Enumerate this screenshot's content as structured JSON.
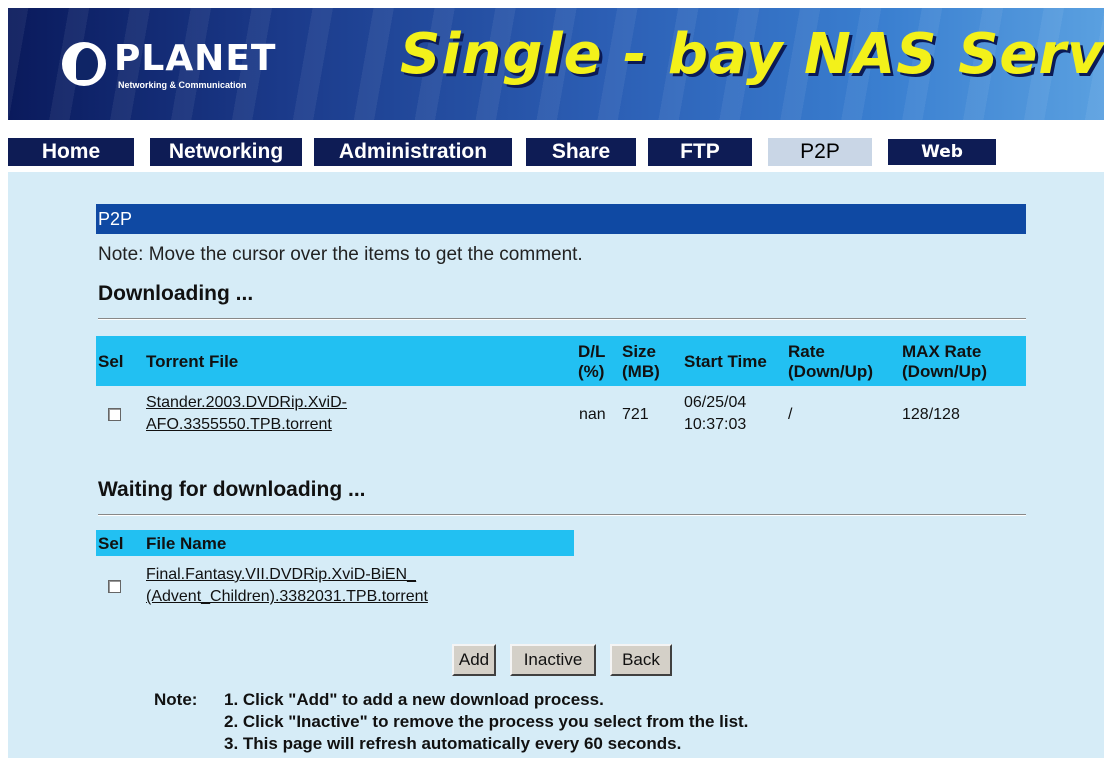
{
  "banner": {
    "logo_text": "PLANET",
    "logo_sub": "Networking & Communication",
    "title": "Single - bay NAS Server"
  },
  "tabs": [
    {
      "label": "Home"
    },
    {
      "label": "Networking"
    },
    {
      "label": "Administration"
    },
    {
      "label": "Share"
    },
    {
      "label": "FTP"
    },
    {
      "label": "P2P"
    },
    {
      "label": "Web Server"
    }
  ],
  "active_tab": "P2P",
  "section": {
    "title": "P2P",
    "note": "Note: Move the cursor over the items to get the comment."
  },
  "downloading": {
    "heading": "Downloading ...",
    "columns": {
      "sel": "Sel",
      "torrent": "Torrent File",
      "dl_1": "D/L",
      "dl_2": "(%)",
      "size_1": "Size",
      "size_2": "(MB)",
      "start": "Start Time",
      "rate_1": "Rate",
      "rate_2": "(Down/Up)",
      "max_1": "MAX Rate",
      "max_2": "(Down/Up)"
    },
    "rows": [
      {
        "file_line1": "Stander.2003.DVDRip.XviD-",
        "file_line2": "AFO.3355550.TPB.torrent",
        "dl": "nan",
        "size": "721",
        "start_date": "06/25/04",
        "start_time": "10:37:03",
        "rate": "/",
        "max_rate": "128/128",
        "selected": false
      }
    ]
  },
  "waiting": {
    "heading": "Waiting for downloading ...",
    "columns": {
      "sel": "Sel",
      "file": "File Name"
    },
    "rows": [
      {
        "file_line1": "Final.Fantasy.VII.DVDRip.XviD-BiEN_",
        "file_line2": "(Advent_Children).3382031.TPB.torrent",
        "selected": false
      }
    ]
  },
  "buttons": {
    "add": "Add",
    "inactive": "Inactive",
    "back": "Back"
  },
  "notes": {
    "label": "Note:",
    "items": [
      "1. Click \"Add\" to add a new download process.",
      "2. Click \"Inactive\" to remove the process you select from the list.",
      "3. This page will refresh automatically every 60 seconds."
    ]
  },
  "colors": {
    "tab_bg": "#0e1c55",
    "tab_active_bg": "#c9d6e6",
    "content_bg": "#d6ecf7",
    "section_header_bg": "#0f49a3",
    "table_header_bg": "#22c0f2",
    "title_yellow": "#f3f11a"
  }
}
